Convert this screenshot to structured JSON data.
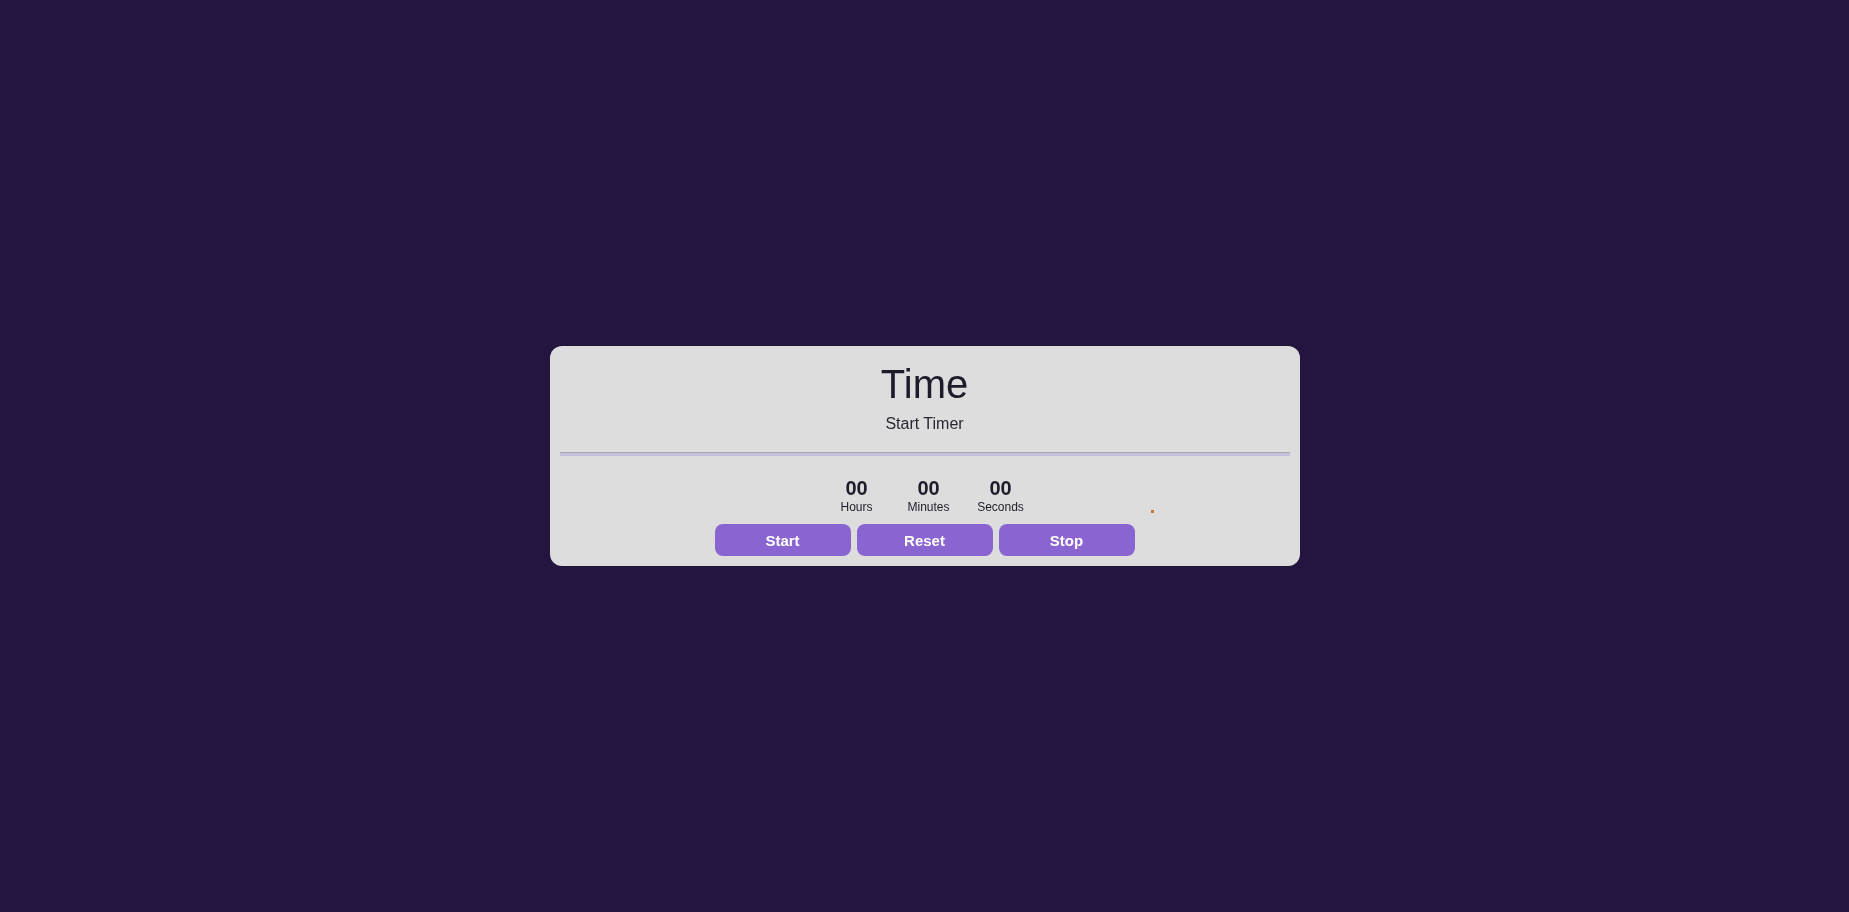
{
  "card": {
    "title": "Time",
    "subtitle": "Start Timer"
  },
  "time_units": [
    {
      "value": "00",
      "label": "Hours"
    },
    {
      "value": "00",
      "label": "Minutes"
    },
    {
      "value": "00",
      "label": "Seconds"
    }
  ],
  "buttons": [
    {
      "label": "Start"
    },
    {
      "label": "Reset"
    },
    {
      "label": "Stop"
    }
  ]
}
